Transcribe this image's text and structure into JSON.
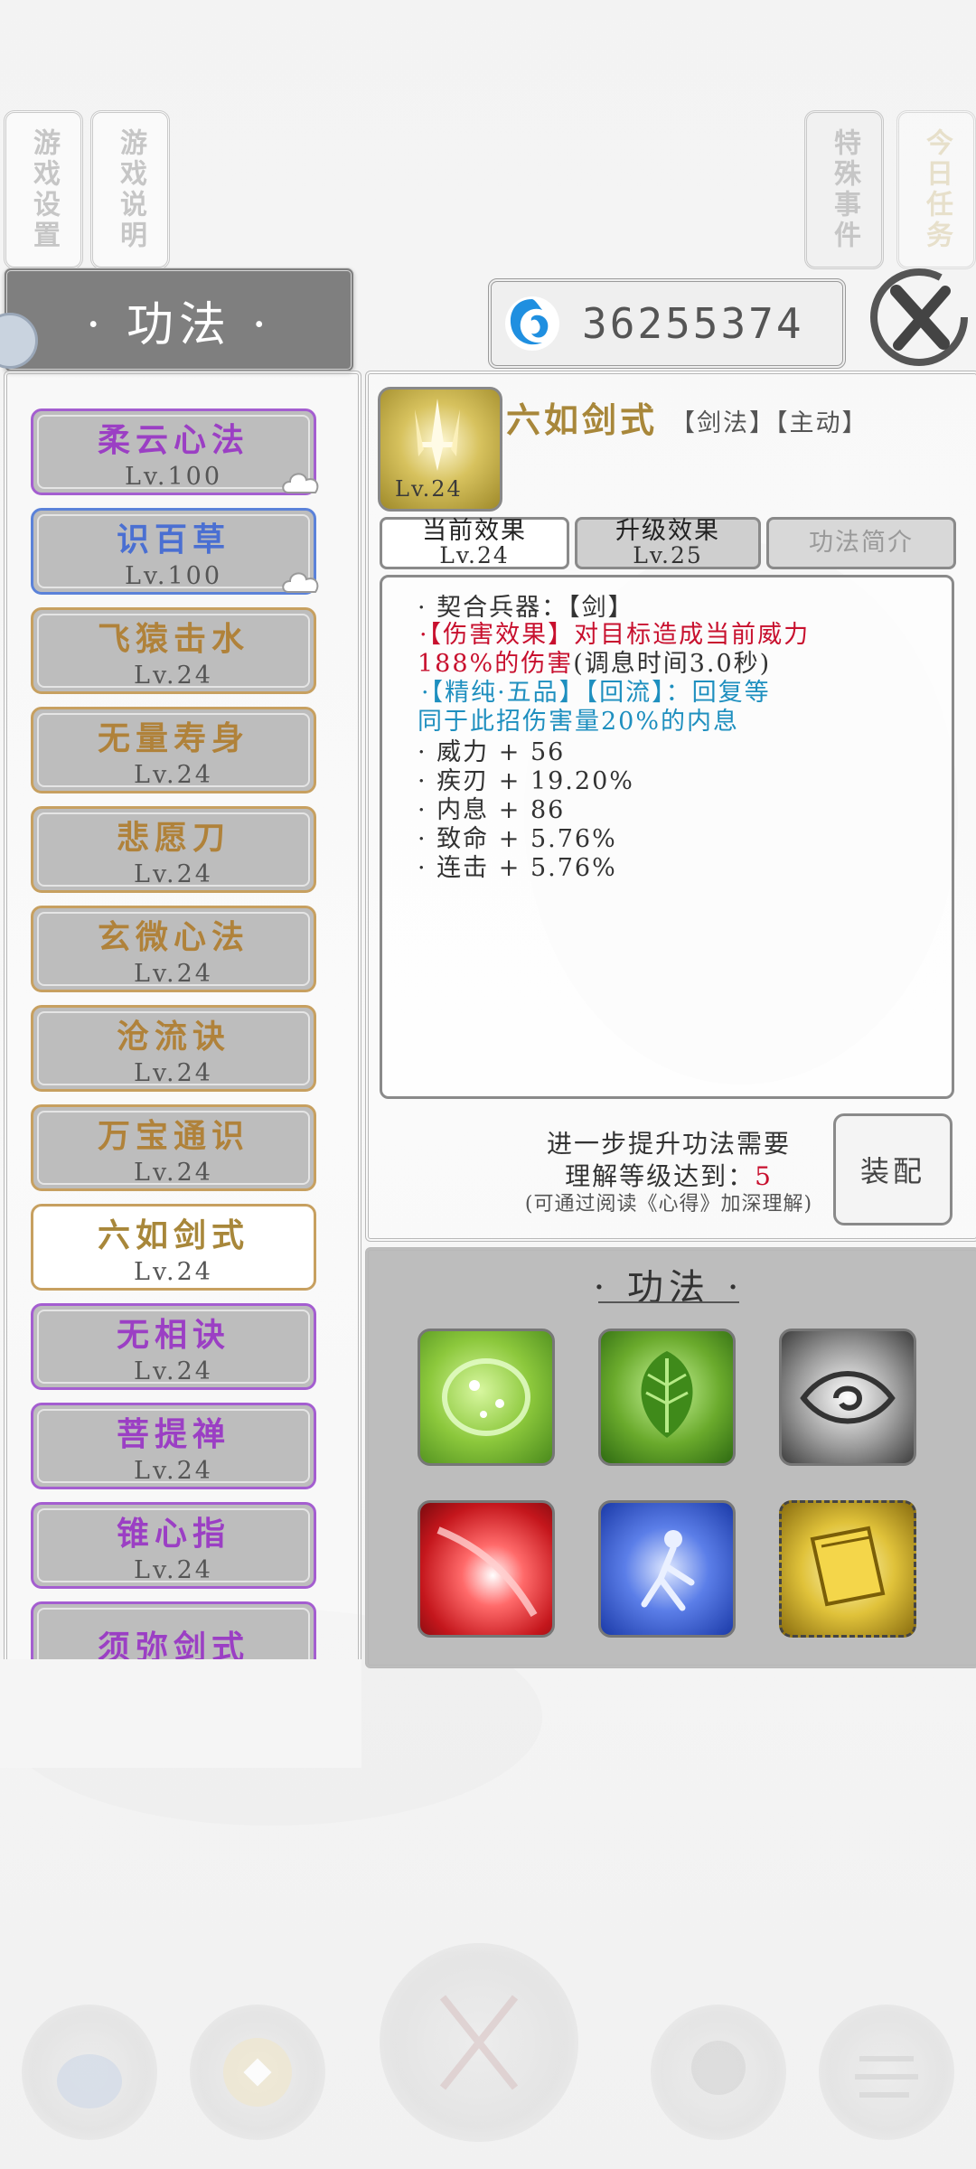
{
  "top_tabs": {
    "game_settings": "游戏设置",
    "game_help": "游戏说明",
    "special_events": "特殊事件",
    "daily_tasks": "今日任务"
  },
  "header": {
    "title": "· 功法 ·",
    "currency_value": "36255374"
  },
  "skill_list": [
    {
      "name": "柔云心法",
      "level": "Lv.100",
      "color": "#9b3fc4",
      "border": "#a45ed0",
      "cloud": true
    },
    {
      "name": "识百草",
      "level": "Lv.100",
      "color": "#4a6fd2",
      "border": "#5b82d9",
      "cloud": true
    },
    {
      "name": "飞猿击水",
      "level": "Lv.24",
      "color": "#b0823a",
      "border": "#c7a060",
      "cloud": false
    },
    {
      "name": "无量寿身",
      "level": "Lv.24",
      "color": "#b0823a",
      "border": "#c7a060",
      "cloud": false
    },
    {
      "name": "悲愿刀",
      "level": "Lv.24",
      "color": "#b0823a",
      "border": "#c7a060",
      "cloud": false
    },
    {
      "name": "玄微心法",
      "level": "Lv.24",
      "color": "#b0823a",
      "border": "#c7a060",
      "cloud": false
    },
    {
      "name": "沧流诀",
      "level": "Lv.24",
      "color": "#b0823a",
      "border": "#c7a060",
      "cloud": false
    },
    {
      "name": "万宝通识",
      "level": "Lv.24",
      "color": "#b0823a",
      "border": "#c7a060",
      "cloud": false
    },
    {
      "name": "六如剑式",
      "level": "Lv.24",
      "color": "#a8873a",
      "border": "#c7a060",
      "cloud": false,
      "selected": true
    },
    {
      "name": "无相诀",
      "level": "Lv.24",
      "color": "#9b3fc4",
      "border": "#a45ed0",
      "cloud": false
    },
    {
      "name": "菩提禅",
      "level": "Lv.24",
      "color": "#9b3fc4",
      "border": "#a45ed0",
      "cloud": false
    },
    {
      "name": "锥心指",
      "level": "Lv.24",
      "color": "#9b3fc4",
      "border": "#a45ed0",
      "cloud": false
    },
    {
      "name": "须弥剑式",
      "level": "",
      "color": "#9b3fc4",
      "border": "#a45ed0",
      "cloud": false
    }
  ],
  "detail": {
    "icon_level": "Lv.24",
    "name": "六如剑式",
    "tags": "【剑法】【主动】",
    "tabs": {
      "current_label": "当前效果",
      "current_level": "Lv.24",
      "upgrade_label": "升级效果",
      "upgrade_level": "Lv.25",
      "intro_label": "功法简介"
    },
    "effects": {
      "weapon": "· 契合兵器：【剑】",
      "damage_l1": "·【伤害效果】对目标造成当前威力",
      "damage_l2": "188%的伤害",
      "damage_l2_suffix": "(调息时间3.0秒)",
      "pure_l1": "·【精纯·五品】【回流】：回复等",
      "pure_l2": "同于此招伤害量20%的内息",
      "stat1": "· 威力 + 56",
      "stat2": "· 疾刃 + 19.20%",
      "stat3": "· 内息 + 86",
      "stat4": "· 致命 + 5.76%",
      "stat5": "· 连击 + 5.76%"
    },
    "upgrade_req": {
      "line1": "进一步提升功法需要",
      "line2_prefix": "理解等级达到：",
      "line2_value": "5",
      "line3": "(可通过阅读《心得》加深理解)"
    },
    "equip_button": "装配"
  },
  "equipped": {
    "title": "· 功法 ·",
    "slots": [
      {
        "icon": "green-orb-icon"
      },
      {
        "icon": "leaf-icon"
      },
      {
        "icon": "eye-icon"
      },
      {
        "icon": "red-slash-icon"
      },
      {
        "icon": "blue-figure-icon"
      },
      {
        "icon": "golden-book-icon"
      }
    ]
  },
  "colors": {
    "damage_red": "#c8102e",
    "pure_blue": "#1e8fbf",
    "gold": "#a8873a",
    "purple": "#9b3fc4"
  }
}
